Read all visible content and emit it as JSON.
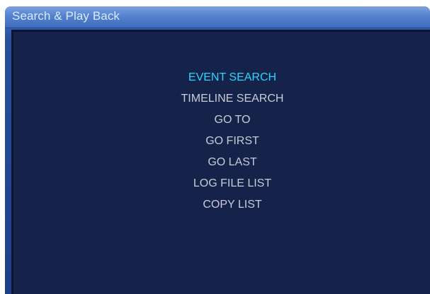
{
  "window": {
    "title": "Search & Play Back"
  },
  "menu": {
    "items": [
      {
        "label": "EVENT SEARCH",
        "selected": true
      },
      {
        "label": "TIMELINE SEARCH",
        "selected": false
      },
      {
        "label": "GO TO",
        "selected": false
      },
      {
        "label": "GO FIRST",
        "selected": false
      },
      {
        "label": "GO LAST",
        "selected": false
      },
      {
        "label": "LOG FILE LIST",
        "selected": false
      },
      {
        "label": "COPY LIST",
        "selected": false
      }
    ]
  },
  "colors": {
    "selected_text": "#2ad7ff",
    "normal_text": "#c9ccd6",
    "panel_bg": "#15234a",
    "titlebar": "#5582cf"
  }
}
